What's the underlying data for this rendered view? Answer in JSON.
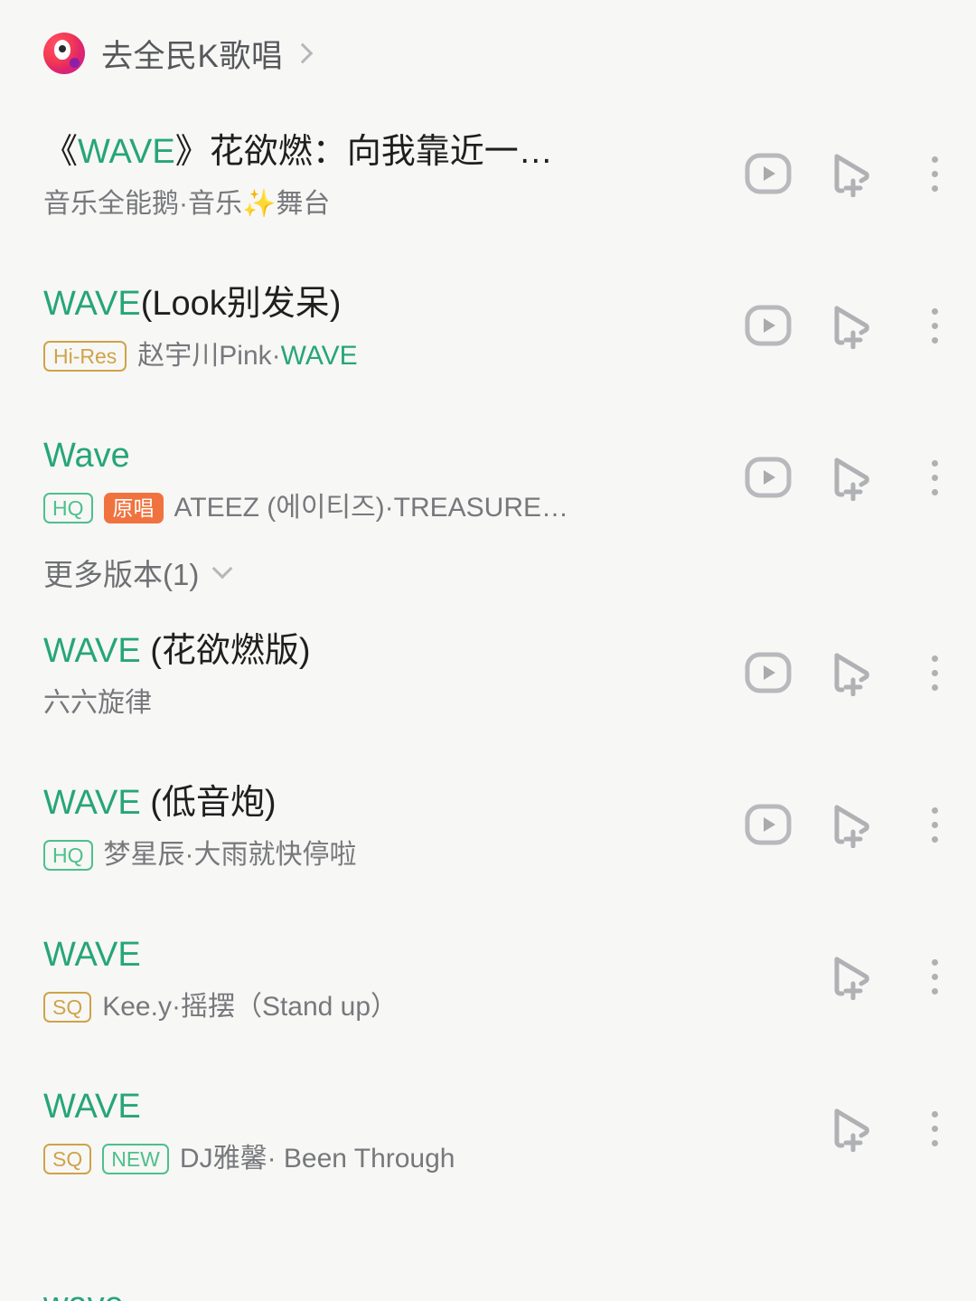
{
  "header": {
    "wesing_label": "去全民K歌唱",
    "logo_name": "wesing-logo",
    "chevron": "chevron-right-icon"
  },
  "more_versions": {
    "label": "更多版本(1)"
  },
  "icons": {
    "mv": "mv-play-icon",
    "add": "add-to-playlist-icon",
    "more": "more-options-icon"
  },
  "colors": {
    "accent_green": "#27a57a",
    "badge_green": "#4cc08c",
    "badge_gold": "#cfa349",
    "badge_orange": "#f0733f",
    "page_bg": "#f7f7f5",
    "title": "#1f1f20",
    "subtitle": "#77787c"
  },
  "songs": [
    {
      "title_parts": [
        {
          "text": "《",
          "hl": false
        },
        {
          "text": "WAVE",
          "hl": true
        },
        {
          "text": "》花欲燃：向我靠近一…",
          "hl": false
        }
      ],
      "title_plain": "《WAVE》花欲燃：向我靠近一…",
      "badges": [],
      "sub_parts": [
        {
          "text": "音乐全能鹅·音乐",
          "hl": false
        },
        {
          "text": "✨",
          "hl": false,
          "sparkle": true
        },
        {
          "text": "舞台",
          "hl": false
        }
      ],
      "sub_plain": "音乐全能鹅·音乐✨舞台",
      "has_mv": true
    },
    {
      "title_parts": [
        {
          "text": "WAVE",
          "hl": true
        },
        {
          "text": "(Look别发呆)",
          "hl": false
        }
      ],
      "title_plain": "WAVE(Look别发呆)",
      "badges": [
        {
          "label": "Hi-Res",
          "style": "hires"
        }
      ],
      "sub_parts": [
        {
          "text": "赵宇川Pink·",
          "hl": false
        },
        {
          "text": "WAVE",
          "hl": true
        }
      ],
      "sub_plain": "赵宇川Pink·WAVE",
      "has_mv": true
    },
    {
      "title_parts": [
        {
          "text": "Wave",
          "hl": true
        }
      ],
      "title_plain": "Wave",
      "badges": [
        {
          "label": "HQ",
          "style": "hq"
        },
        {
          "label": "原唱",
          "style": "orig"
        }
      ],
      "sub_parts": [
        {
          "text": "ATEEZ (에이티즈)·TREASURE…",
          "hl": false
        }
      ],
      "sub_plain": "ATEEZ (에이티즈)·TREASURE…",
      "has_mv": true,
      "has_more_versions": true
    },
    {
      "title_parts": [
        {
          "text": "WAVE",
          "hl": true
        },
        {
          "text": " (花欲燃版)",
          "hl": false
        }
      ],
      "title_plain": "WAVE (花欲燃版)",
      "badges": [],
      "sub_parts": [
        {
          "text": "六六旋律",
          "hl": false
        }
      ],
      "sub_plain": "六六旋律",
      "has_mv": true
    },
    {
      "title_parts": [
        {
          "text": "WAVE",
          "hl": true
        },
        {
          "text": " (低音炮)",
          "hl": false
        }
      ],
      "title_plain": "WAVE (低音炮)",
      "badges": [
        {
          "label": "HQ",
          "style": "hq"
        }
      ],
      "sub_parts": [
        {
          "text": "梦星辰·大雨就快停啦",
          "hl": false
        }
      ],
      "sub_plain": "梦星辰·大雨就快停啦",
      "has_mv": true
    },
    {
      "title_parts": [
        {
          "text": "WAVE",
          "hl": true
        }
      ],
      "title_plain": "WAVE",
      "badges": [
        {
          "label": "SQ",
          "style": "sq"
        }
      ],
      "sub_parts": [
        {
          "text": "Kee.y·摇摆（Stand up）",
          "hl": false
        }
      ],
      "sub_plain": "Kee.y·摇摆（Stand up）",
      "has_mv": false
    },
    {
      "title_parts": [
        {
          "text": "WAVE",
          "hl": true
        }
      ],
      "title_plain": "WAVE",
      "badges": [
        {
          "label": "SQ",
          "style": "sq"
        },
        {
          "label": "NEW",
          "style": "new"
        }
      ],
      "sub_parts": [
        {
          "text": "DJ雅馨· Been Through",
          "hl": false
        }
      ],
      "sub_plain": "DJ雅馨· Been Through",
      "has_mv": false
    }
  ],
  "cut_off_row": {
    "title_plain": "wave"
  }
}
